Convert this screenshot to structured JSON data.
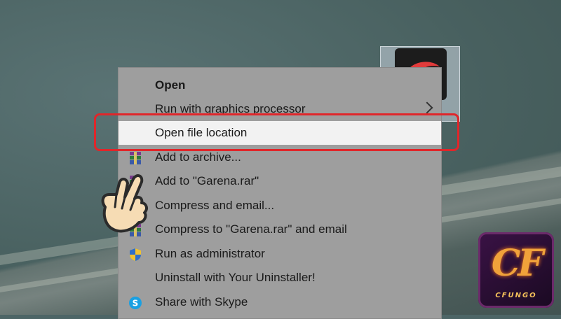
{
  "context_menu": {
    "items": [
      {
        "label": "Open",
        "icon": "none",
        "bold": true
      },
      {
        "label": "Run with graphics processor",
        "icon": "none",
        "submenu": true
      },
      {
        "label": "Open file location",
        "icon": "none",
        "highlighted": true
      },
      {
        "label": "Add to archive...",
        "icon": "winrar-icon"
      },
      {
        "label": "Add to \"Garena.rar\"",
        "icon": "winrar-icon"
      },
      {
        "label": "Compress and email...",
        "icon": "winrar-icon"
      },
      {
        "label": "Compress to \"Garena.rar\" and email",
        "icon": "winrar-icon"
      },
      {
        "label": "Run as administrator",
        "icon": "uac-shield-icon"
      },
      {
        "label": "Uninstall with Your Uninstaller!",
        "icon": "none"
      },
      {
        "label": "Share with Skype",
        "icon": "skype-icon"
      }
    ]
  },
  "watermark": {
    "logo_text": "CF",
    "brand_text": "CFUNGO"
  },
  "colors": {
    "highlight_box": "#e0262a",
    "menu_background": "#9e9e9e",
    "highlight_row": "#f2f2f2"
  }
}
